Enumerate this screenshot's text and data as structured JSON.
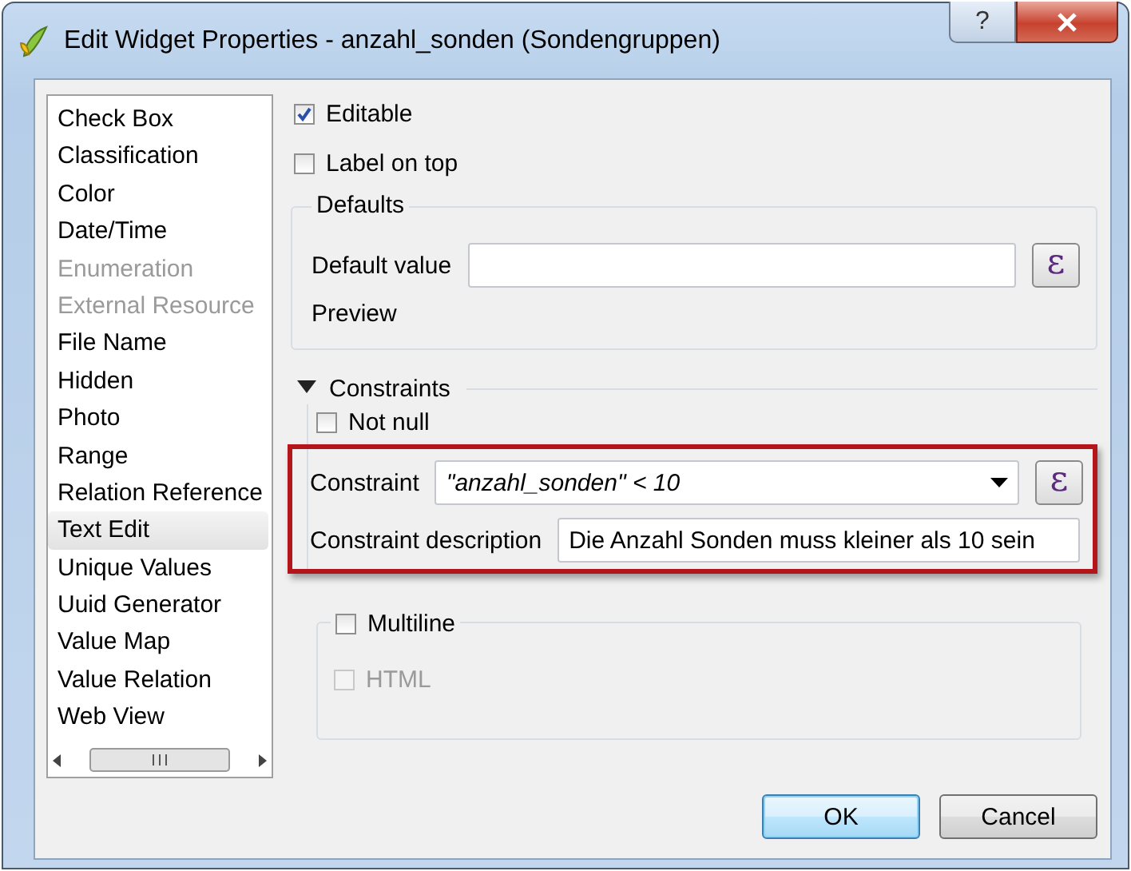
{
  "window": {
    "title": "Edit Widget Properties - anzahl_sonden (Sondengruppen)",
    "help_button": "?"
  },
  "widget_types": [
    {
      "label": "Check Box",
      "selected": false,
      "disabled": false
    },
    {
      "label": "Classification",
      "selected": false,
      "disabled": false
    },
    {
      "label": "Color",
      "selected": false,
      "disabled": false
    },
    {
      "label": "Date/Time",
      "selected": false,
      "disabled": false
    },
    {
      "label": "Enumeration",
      "selected": false,
      "disabled": true
    },
    {
      "label": "External Resource",
      "selected": false,
      "disabled": true
    },
    {
      "label": "File Name",
      "selected": false,
      "disabled": false
    },
    {
      "label": "Hidden",
      "selected": false,
      "disabled": false
    },
    {
      "label": "Photo",
      "selected": false,
      "disabled": false
    },
    {
      "label": "Range",
      "selected": false,
      "disabled": false
    },
    {
      "label": "Relation Reference",
      "selected": false,
      "disabled": false
    },
    {
      "label": "Text Edit",
      "selected": true,
      "disabled": false
    },
    {
      "label": "Unique Values",
      "selected": false,
      "disabled": false
    },
    {
      "label": "Uuid Generator",
      "selected": false,
      "disabled": false
    },
    {
      "label": "Value Map",
      "selected": false,
      "disabled": false
    },
    {
      "label": "Value Relation",
      "selected": false,
      "disabled": false
    },
    {
      "label": "Web View",
      "selected": false,
      "disabled": false
    }
  ],
  "editable": {
    "label": "Editable",
    "checked": true
  },
  "label_on_top": {
    "label": "Label on top",
    "checked": false
  },
  "defaults": {
    "title": "Defaults",
    "default_value_label": "Default value",
    "expression_button": "ɛ",
    "preview_label": "Preview"
  },
  "constraints": {
    "title": "Constraints",
    "expanded": true,
    "not_null": {
      "label": "Not null",
      "checked": false
    },
    "constraint_label": "Constraint",
    "constraint_value": "\"anzahl_sonden\" < 10",
    "expression_button": "ɛ",
    "description_label": "Constraint description",
    "description_value": "Die Anzahl Sonden muss kleiner als 10 sein"
  },
  "multiline": {
    "label": "Multiline",
    "checked": false,
    "html": {
      "label": "HTML",
      "checked": false,
      "disabled": true
    }
  },
  "buttons": [
    "OK",
    "Cancel"
  ]
}
